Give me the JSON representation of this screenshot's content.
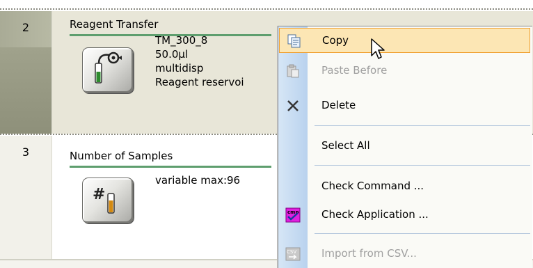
{
  "steps": [
    {
      "number": "2",
      "title": "Reagent Transfer",
      "icon": "reagent-transfer-icon",
      "details": [
        "TM_300_8",
        "50.0µl",
        "multidisp",
        "Reagent reservoi"
      ]
    },
    {
      "number": "3",
      "title": "Number of Samples",
      "icon": "number-of-samples-icon",
      "details": [
        "variable max:96"
      ]
    }
  ],
  "context_menu": {
    "items": [
      {
        "label": "Copy",
        "icon": "copy-icon",
        "enabled": true,
        "highlighted": true
      },
      {
        "label": "Paste Before",
        "icon": "paste-icon",
        "enabled": false
      },
      {
        "label": "Delete",
        "icon": "delete-x-icon",
        "enabled": true
      },
      {
        "label": "Select All",
        "icon": "",
        "enabled": true
      },
      {
        "label": "Check Command ...",
        "icon": "",
        "enabled": true
      },
      {
        "label": "Check Application ...",
        "icon": "check-application-icon",
        "enabled": true,
        "icon_text": "cmp"
      },
      {
        "label": "Import from CSV...",
        "icon": "import-csv-icon",
        "enabled": false,
        "icon_text": "CSV"
      }
    ]
  },
  "colors": {
    "selected_row": "#e8e6d8",
    "title_underline": "#5e9e6e",
    "menu_highlight": "#fce6b4",
    "menu_highlight_border": "#f0a030",
    "menu_strip": "#c8dcf2"
  }
}
